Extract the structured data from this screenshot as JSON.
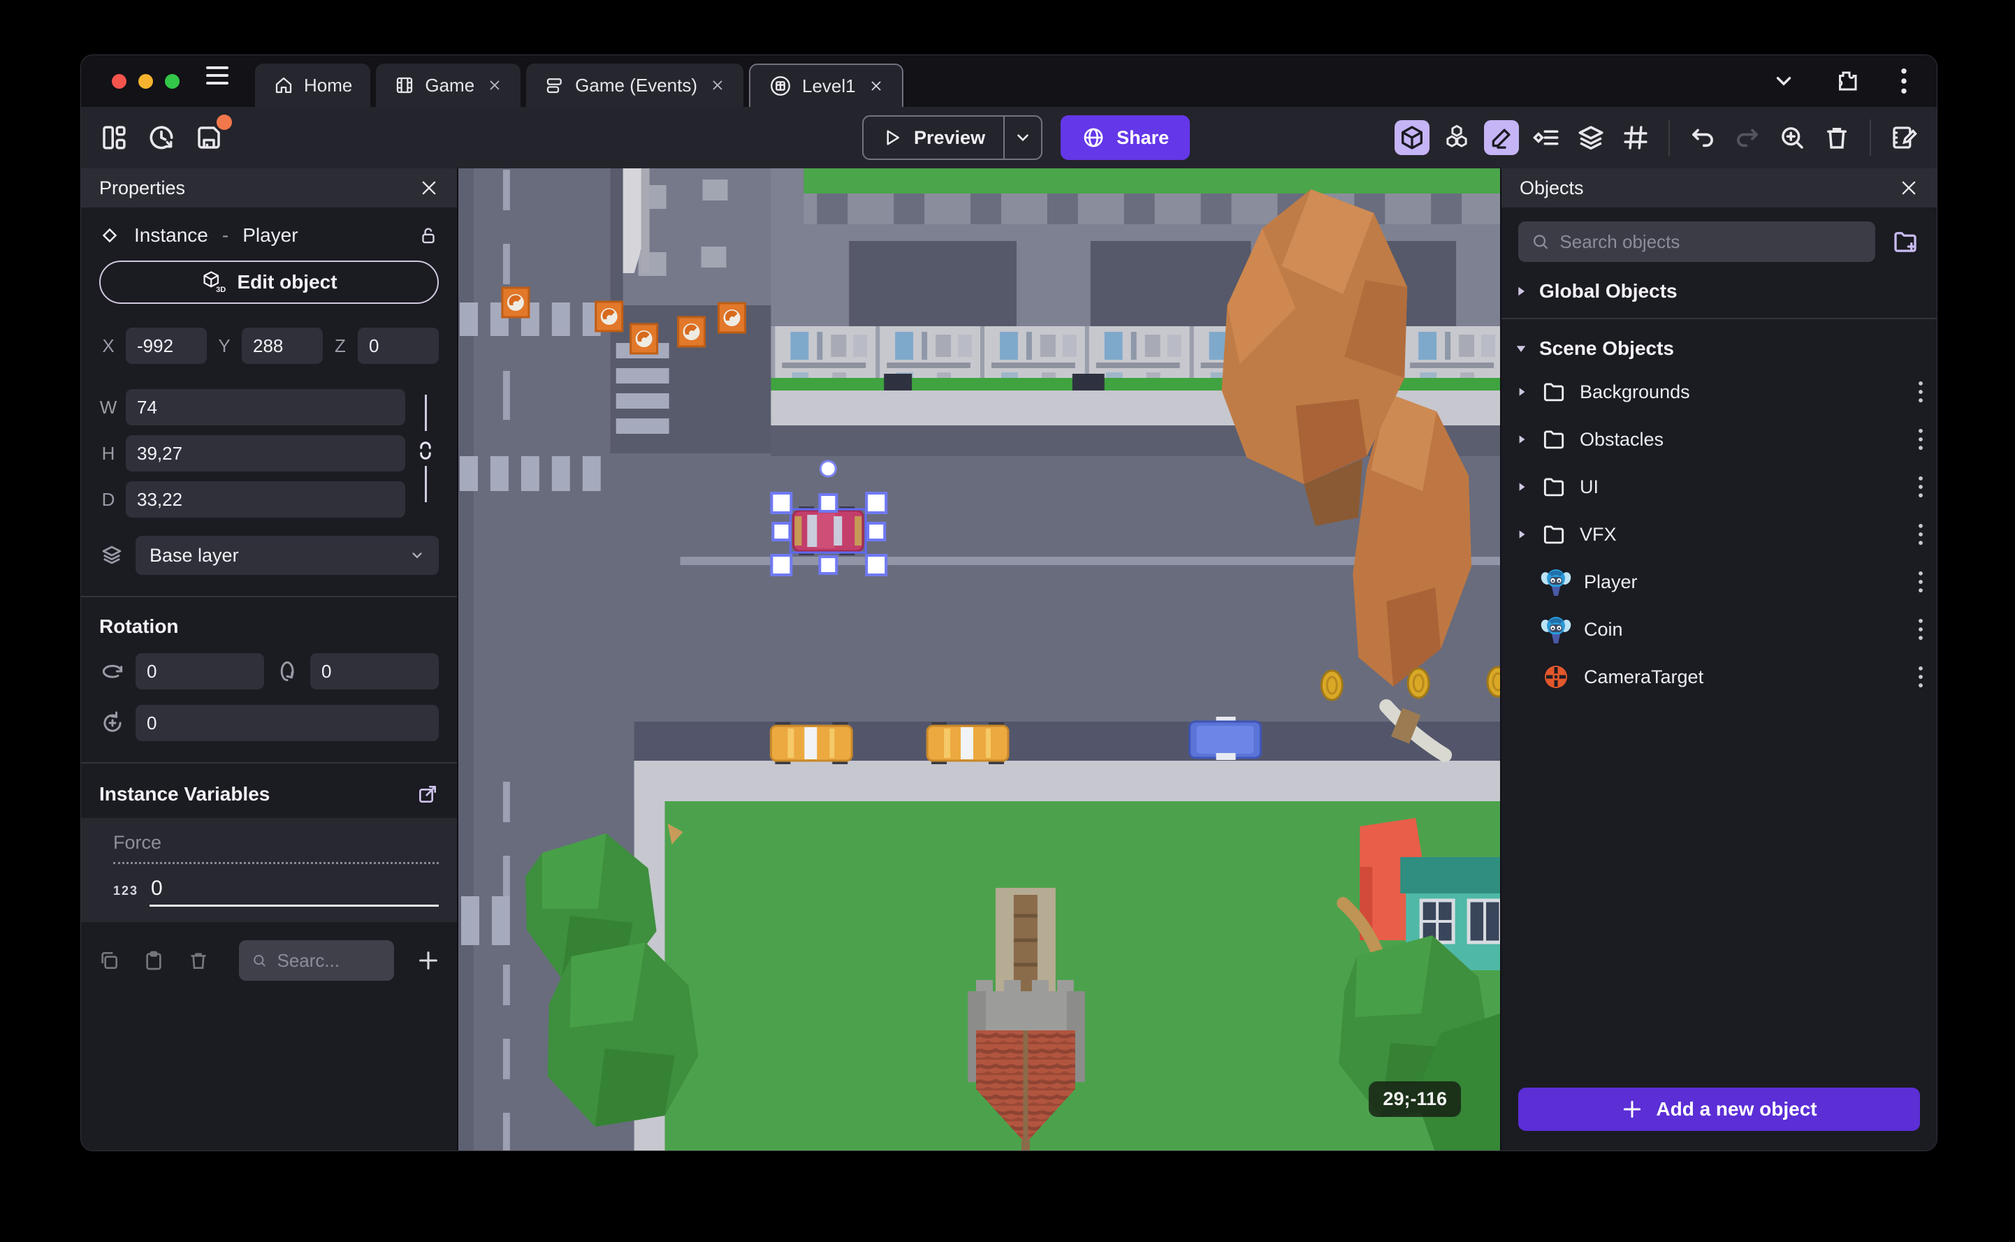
{
  "titlebar": {
    "tabs": [
      {
        "label": "Home"
      },
      {
        "label": "Game"
      },
      {
        "label": "Game (Events)"
      },
      {
        "label": "Level1"
      }
    ]
  },
  "toolbar": {
    "preview": "Preview",
    "share": "Share"
  },
  "properties": {
    "title": "Properties",
    "instance_label": "Instance",
    "dash": "-",
    "instance_name": "Player",
    "edit_object": "Edit object",
    "x_label": "X",
    "x": "-992",
    "y_label": "Y",
    "y": "288",
    "z_label": "Z",
    "z": "0",
    "w_label": "W",
    "w": "74",
    "h_label": "H",
    "h": "39,27",
    "d_label": "D",
    "d": "33,22",
    "layer": "Base layer",
    "rotation_title": "Rotation",
    "rot_x": "0",
    "rot_y": "0",
    "rot_z": "0",
    "variables_title": "Instance Variables",
    "variable_name": "Force",
    "variable_type": "123",
    "variable_value": "0",
    "variables_search_placeholder": "Searc..."
  },
  "objects": {
    "title": "Objects",
    "search_placeholder": "Search objects",
    "global_section": "Global Objects",
    "scene_section": "Scene Objects",
    "items": [
      {
        "label": "Backgrounds"
      },
      {
        "label": "Obstacles"
      },
      {
        "label": "UI"
      },
      {
        "label": "VFX"
      },
      {
        "label": "Player"
      },
      {
        "label": "Coin"
      },
      {
        "label": "CameraTarget"
      }
    ],
    "add_button": "Add a new object"
  },
  "canvas": {
    "cursor_coordinates": "29;-116"
  },
  "colors": {
    "accent_purple": "#6437E8",
    "add_button_purple": "#5B2ED6",
    "active_tool_lavender": "#C5B4F6",
    "selection_blue": "#5F6BF5",
    "unsaved_alert_orange": "#F2784B",
    "traffic_red": "#F5544D",
    "traffic_yellow": "#F6B42E",
    "traffic_green": "#33C748"
  }
}
